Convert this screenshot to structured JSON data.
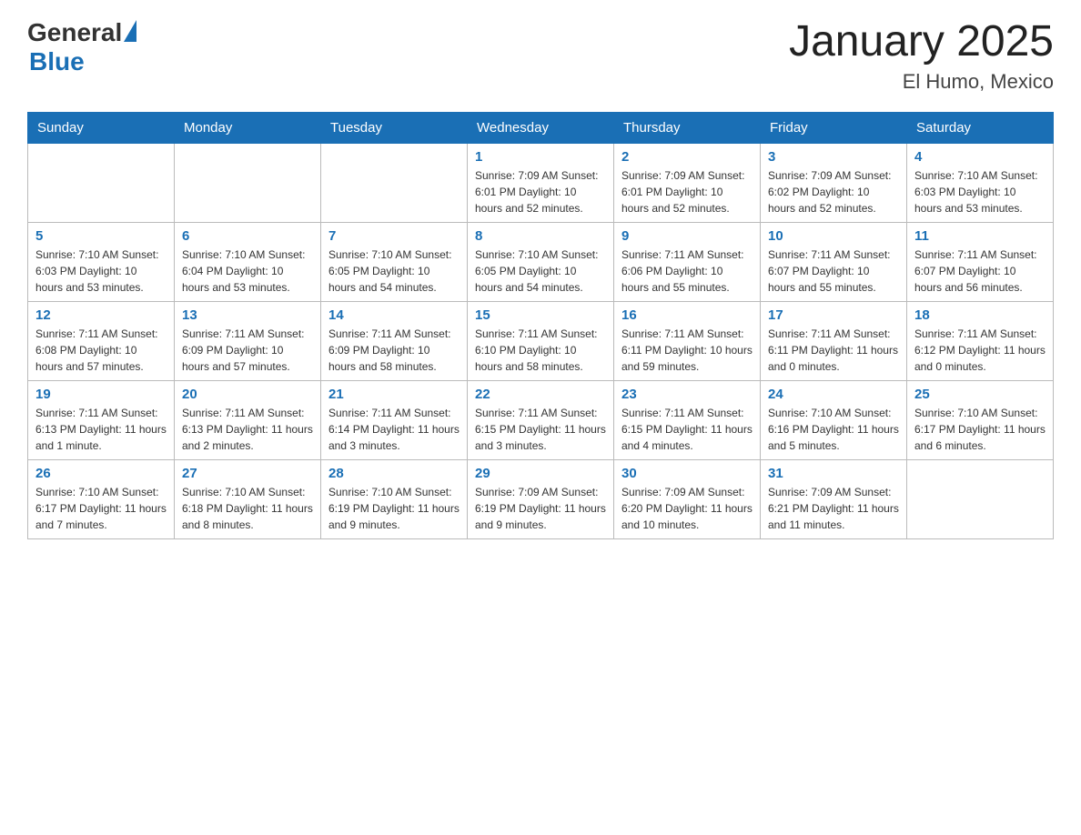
{
  "header": {
    "logo": {
      "general": "General",
      "blue": "Blue"
    },
    "title": "January 2025",
    "subtitle": "El Humo, Mexico"
  },
  "weekdays": [
    "Sunday",
    "Monday",
    "Tuesday",
    "Wednesday",
    "Thursday",
    "Friday",
    "Saturday"
  ],
  "weeks": [
    [
      {
        "day": "",
        "info": ""
      },
      {
        "day": "",
        "info": ""
      },
      {
        "day": "",
        "info": ""
      },
      {
        "day": "1",
        "info": "Sunrise: 7:09 AM\nSunset: 6:01 PM\nDaylight: 10 hours and 52 minutes."
      },
      {
        "day": "2",
        "info": "Sunrise: 7:09 AM\nSunset: 6:01 PM\nDaylight: 10 hours and 52 minutes."
      },
      {
        "day": "3",
        "info": "Sunrise: 7:09 AM\nSunset: 6:02 PM\nDaylight: 10 hours and 52 minutes."
      },
      {
        "day": "4",
        "info": "Sunrise: 7:10 AM\nSunset: 6:03 PM\nDaylight: 10 hours and 53 minutes."
      }
    ],
    [
      {
        "day": "5",
        "info": "Sunrise: 7:10 AM\nSunset: 6:03 PM\nDaylight: 10 hours and 53 minutes."
      },
      {
        "day": "6",
        "info": "Sunrise: 7:10 AM\nSunset: 6:04 PM\nDaylight: 10 hours and 53 minutes."
      },
      {
        "day": "7",
        "info": "Sunrise: 7:10 AM\nSunset: 6:05 PM\nDaylight: 10 hours and 54 minutes."
      },
      {
        "day": "8",
        "info": "Sunrise: 7:10 AM\nSunset: 6:05 PM\nDaylight: 10 hours and 54 minutes."
      },
      {
        "day": "9",
        "info": "Sunrise: 7:11 AM\nSunset: 6:06 PM\nDaylight: 10 hours and 55 minutes."
      },
      {
        "day": "10",
        "info": "Sunrise: 7:11 AM\nSunset: 6:07 PM\nDaylight: 10 hours and 55 minutes."
      },
      {
        "day": "11",
        "info": "Sunrise: 7:11 AM\nSunset: 6:07 PM\nDaylight: 10 hours and 56 minutes."
      }
    ],
    [
      {
        "day": "12",
        "info": "Sunrise: 7:11 AM\nSunset: 6:08 PM\nDaylight: 10 hours and 57 minutes."
      },
      {
        "day": "13",
        "info": "Sunrise: 7:11 AM\nSunset: 6:09 PM\nDaylight: 10 hours and 57 minutes."
      },
      {
        "day": "14",
        "info": "Sunrise: 7:11 AM\nSunset: 6:09 PM\nDaylight: 10 hours and 58 minutes."
      },
      {
        "day": "15",
        "info": "Sunrise: 7:11 AM\nSunset: 6:10 PM\nDaylight: 10 hours and 58 minutes."
      },
      {
        "day": "16",
        "info": "Sunrise: 7:11 AM\nSunset: 6:11 PM\nDaylight: 10 hours and 59 minutes."
      },
      {
        "day": "17",
        "info": "Sunrise: 7:11 AM\nSunset: 6:11 PM\nDaylight: 11 hours and 0 minutes."
      },
      {
        "day": "18",
        "info": "Sunrise: 7:11 AM\nSunset: 6:12 PM\nDaylight: 11 hours and 0 minutes."
      }
    ],
    [
      {
        "day": "19",
        "info": "Sunrise: 7:11 AM\nSunset: 6:13 PM\nDaylight: 11 hours and 1 minute."
      },
      {
        "day": "20",
        "info": "Sunrise: 7:11 AM\nSunset: 6:13 PM\nDaylight: 11 hours and 2 minutes."
      },
      {
        "day": "21",
        "info": "Sunrise: 7:11 AM\nSunset: 6:14 PM\nDaylight: 11 hours and 3 minutes."
      },
      {
        "day": "22",
        "info": "Sunrise: 7:11 AM\nSunset: 6:15 PM\nDaylight: 11 hours and 3 minutes."
      },
      {
        "day": "23",
        "info": "Sunrise: 7:11 AM\nSunset: 6:15 PM\nDaylight: 11 hours and 4 minutes."
      },
      {
        "day": "24",
        "info": "Sunrise: 7:10 AM\nSunset: 6:16 PM\nDaylight: 11 hours and 5 minutes."
      },
      {
        "day": "25",
        "info": "Sunrise: 7:10 AM\nSunset: 6:17 PM\nDaylight: 11 hours and 6 minutes."
      }
    ],
    [
      {
        "day": "26",
        "info": "Sunrise: 7:10 AM\nSunset: 6:17 PM\nDaylight: 11 hours and 7 minutes."
      },
      {
        "day": "27",
        "info": "Sunrise: 7:10 AM\nSunset: 6:18 PM\nDaylight: 11 hours and 8 minutes."
      },
      {
        "day": "28",
        "info": "Sunrise: 7:10 AM\nSunset: 6:19 PM\nDaylight: 11 hours and 9 minutes."
      },
      {
        "day": "29",
        "info": "Sunrise: 7:09 AM\nSunset: 6:19 PM\nDaylight: 11 hours and 9 minutes."
      },
      {
        "day": "30",
        "info": "Sunrise: 7:09 AM\nSunset: 6:20 PM\nDaylight: 11 hours and 10 minutes."
      },
      {
        "day": "31",
        "info": "Sunrise: 7:09 AM\nSunset: 6:21 PM\nDaylight: 11 hours and 11 minutes."
      },
      {
        "day": "",
        "info": ""
      }
    ]
  ],
  "colors": {
    "header_bg": "#1a6fb5",
    "accent": "#1a6fb5"
  }
}
